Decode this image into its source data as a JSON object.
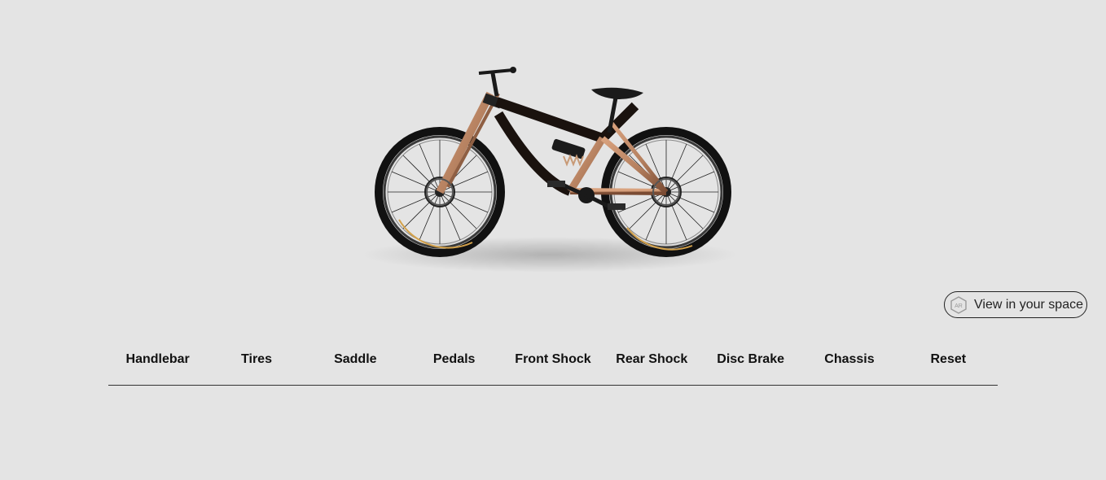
{
  "viewer": {
    "model_name": "downhill-bike",
    "frame_color": "#b5805f",
    "accent_color": "#111111"
  },
  "ar_button": {
    "label": "View in your space",
    "icon": "ar-cube-icon",
    "icon_text": "AR"
  },
  "parts_nav": {
    "items": [
      {
        "id": "handlebar",
        "label": "Handlebar"
      },
      {
        "id": "tires",
        "label": "Tires"
      },
      {
        "id": "saddle",
        "label": "Saddle"
      },
      {
        "id": "pedals",
        "label": "Pedals"
      },
      {
        "id": "front-shock",
        "label": "Front Shock"
      },
      {
        "id": "rear-shock",
        "label": "Rear Shock"
      },
      {
        "id": "disc-brake",
        "label": "Disc Brake"
      },
      {
        "id": "chassis",
        "label": "Chassis"
      },
      {
        "id": "reset",
        "label": "Reset"
      }
    ]
  }
}
